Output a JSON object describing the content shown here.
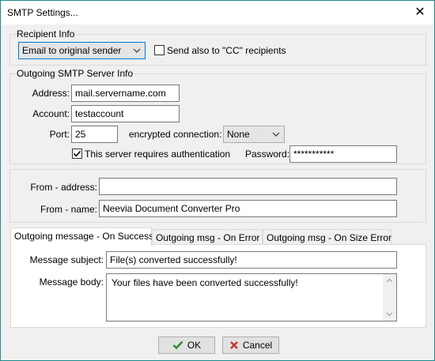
{
  "window": {
    "title": "SMTP Settings..."
  },
  "recipient_info": {
    "label": "Recipient Info",
    "selected_option": "Email to original sender",
    "cc_checkbox_label": "Send also to \"CC\" recipients",
    "cc_checked": false
  },
  "smtp": {
    "label": "Outgoing SMTP Server Info",
    "address_label": "Address:",
    "address_value": "mail.servername.com",
    "account_label": "Account:",
    "account_value": "testaccount",
    "port_label": "Port:",
    "port_value": "25",
    "encrypted_label": "encrypted connection:",
    "encrypted_value": "None",
    "auth_label": "This server requires authentication",
    "auth_checked": true,
    "password_label": "Password:",
    "password_value": "***********"
  },
  "from": {
    "address_label": "From - address:",
    "address_value": "",
    "name_label": "From - name:",
    "name_value": "Neevia Document Converter Pro"
  },
  "tabs": [
    {
      "label": "Outgoing message - On Success",
      "active": true
    },
    {
      "label": "Outgoing msg - On Error",
      "active": false
    },
    {
      "label": "Outgoing msg - On Size Error",
      "active": false
    }
  ],
  "message": {
    "subject_label": "Message subject:",
    "subject_value": "File(s) converted successfully!",
    "body_label": "Message body:",
    "body_value": "Your files have been converted successfully!"
  },
  "buttons": {
    "ok_label": "OK",
    "cancel_label": "Cancel"
  },
  "colors": {
    "ok_check": "#2e8b2e",
    "cancel_x": "#c0392b",
    "title_bar": "#ffffff",
    "dialog_bg": "#f0f0f0"
  }
}
